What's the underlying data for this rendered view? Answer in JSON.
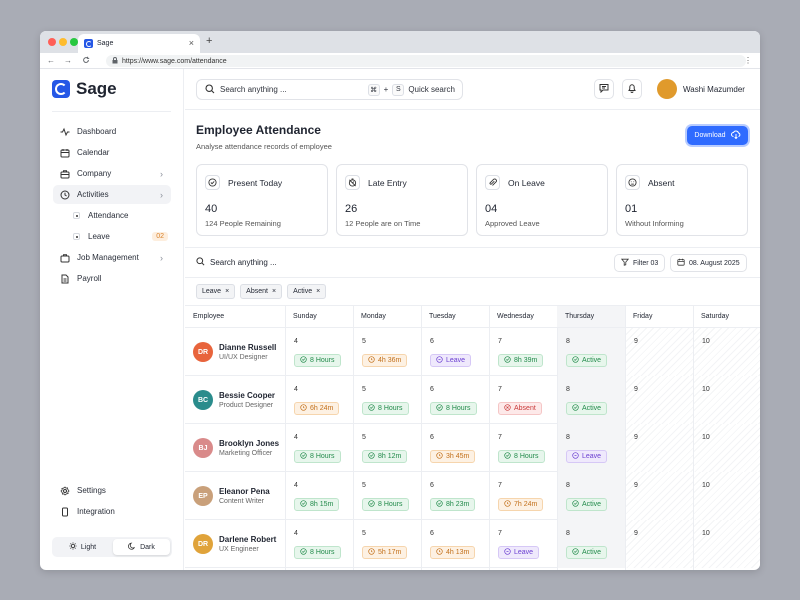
{
  "browser": {
    "tab_title": "Sage",
    "new_tab": "+",
    "close": "×",
    "url": "https://www.sage.com/attendance",
    "back": "←",
    "forward": "→",
    "reload": "C",
    "menu": "⋮"
  },
  "brand": {
    "name": "Sage",
    "accent": "#2557e6"
  },
  "sidebar": {
    "items": [
      {
        "label": "Dashboard",
        "icon": "activity-icon"
      },
      {
        "label": "Calendar",
        "icon": "calendar-icon"
      },
      {
        "label": "Company",
        "icon": "briefcase-icon",
        "chevron": "›"
      },
      {
        "label": "Activities",
        "icon": "clock-icon",
        "chevron": "›"
      },
      {
        "label": "Job Management",
        "icon": "briefcase-icon",
        "chevron": "›"
      },
      {
        "label": "Payroll",
        "icon": "document-icon"
      }
    ],
    "subitems": [
      {
        "label": "Attendance"
      },
      {
        "label": "Leave",
        "badge": "02"
      }
    ],
    "bottom": [
      {
        "label": "Settings",
        "icon": "gear-icon"
      },
      {
        "label": "Integration",
        "icon": "phone-icon"
      }
    ],
    "theme": {
      "light": "Light",
      "dark": "Dark"
    }
  },
  "topbar": {
    "search_placeholder": "Search anything ...",
    "kbd1": "⌘",
    "plus": "+",
    "kbd2": "S",
    "quick": "Quick search",
    "user": "Washi Mazumder"
  },
  "page": {
    "title": "Employee Attendance",
    "subtitle": "Analyse attendance records of employee",
    "download": "Download"
  },
  "cards": [
    {
      "title": "Present Today",
      "value": "40",
      "sub": "124 People Remaining",
      "icon": "check-circle-icon"
    },
    {
      "title": "Late Entry",
      "value": "26",
      "sub": "12 People are on Time",
      "icon": "timer-icon"
    },
    {
      "title": "On Leave",
      "value": "04",
      "sub": "Approved Leave",
      "icon": "paperclip-icon"
    },
    {
      "title": "Absent",
      "value": "01",
      "sub": "Without Informing",
      "icon": "face-icon"
    }
  ],
  "filters": {
    "search": "Search anything ...",
    "filter": "Filter 03",
    "date": "08. August 2025",
    "chips": [
      "Leave",
      "Absent",
      "Active"
    ],
    "chip_close": "×"
  },
  "table": {
    "headers": [
      "Employee",
      "Sunday",
      "Monday",
      "Tuesday",
      "Wednesday",
      "Thursday",
      "Friday",
      "Saturday"
    ],
    "rows": [
      {
        "name": "Dianne Russell",
        "role": "UI/UX Designer",
        "avatar_color": "#e8643c",
        "initials": "DR",
        "days": [
          {
            "d": "4",
            "s": "8 Hours",
            "t": "green"
          },
          {
            "d": "5",
            "s": "4h 36m",
            "t": "orange"
          },
          {
            "d": "6",
            "s": "Leave",
            "t": "purple"
          },
          {
            "d": "7",
            "s": "8h 39m",
            "t": "green"
          },
          {
            "d": "8",
            "s": "Active",
            "t": "green"
          },
          {
            "d": "9"
          },
          {
            "d": "10"
          }
        ]
      },
      {
        "name": "Bessie Cooper",
        "role": "Product Designer",
        "avatar_color": "#2a8c8c",
        "initials": "BC",
        "days": [
          {
            "d": "4",
            "s": "6h 24m",
            "t": "orange"
          },
          {
            "d": "5",
            "s": "8 Hours",
            "t": "green"
          },
          {
            "d": "6",
            "s": "8 Hours",
            "t": "green"
          },
          {
            "d": "7",
            "s": "Absent",
            "t": "red"
          },
          {
            "d": "8",
            "s": "Active",
            "t": "green"
          },
          {
            "d": "9"
          },
          {
            "d": "10"
          }
        ]
      },
      {
        "name": "Brooklyn Jones",
        "role": "Marketing Officer",
        "avatar_color": "#d98a8a",
        "initials": "BJ",
        "days": [
          {
            "d": "4",
            "s": "8 Hours",
            "t": "green"
          },
          {
            "d": "5",
            "s": "8h 12m",
            "t": "green"
          },
          {
            "d": "6",
            "s": "3h 45m",
            "t": "orange"
          },
          {
            "d": "7",
            "s": "8 Hours",
            "t": "green"
          },
          {
            "d": "8",
            "s": "Leave",
            "t": "purple"
          },
          {
            "d": "9"
          },
          {
            "d": "10"
          }
        ]
      },
      {
        "name": "Eleanor Pena",
        "role": "Content Writer",
        "avatar_color": "#c9a07a",
        "initials": "EP",
        "days": [
          {
            "d": "4",
            "s": "8h 15m",
            "t": "green"
          },
          {
            "d": "5",
            "s": "8 Hours",
            "t": "green"
          },
          {
            "d": "6",
            "s": "8h 23m",
            "t": "green"
          },
          {
            "d": "7",
            "s": "7h 24m",
            "t": "orange"
          },
          {
            "d": "8",
            "s": "Active",
            "t": "green"
          },
          {
            "d": "9"
          },
          {
            "d": "10"
          }
        ]
      },
      {
        "name": "Darlene Robert",
        "role": "UX Engineer",
        "avatar_color": "#e0a33a",
        "initials": "DR",
        "days": [
          {
            "d": "4",
            "s": "8 Hours",
            "t": "green"
          },
          {
            "d": "5",
            "s": "5h 17m",
            "t": "orange"
          },
          {
            "d": "6",
            "s": "4h 13m",
            "t": "orange"
          },
          {
            "d": "7",
            "s": "Leave",
            "t": "purple"
          },
          {
            "d": "8",
            "s": "Active",
            "t": "green"
          },
          {
            "d": "9"
          },
          {
            "d": "10"
          }
        ]
      }
    ]
  }
}
